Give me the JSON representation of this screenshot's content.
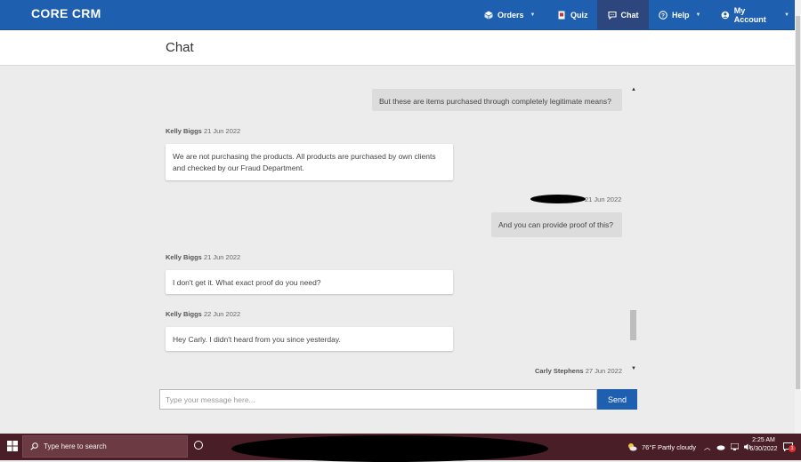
{
  "nav": {
    "brand": "CORE CRM",
    "items": [
      {
        "label": "Orders",
        "icon": "orders-icon",
        "dropdown": true
      },
      {
        "label": "Quiz",
        "icon": "quiz-icon",
        "dropdown": false
      },
      {
        "label": "Chat",
        "icon": "chat-icon",
        "dropdown": false,
        "active": true
      },
      {
        "label": "Help",
        "icon": "help-icon",
        "dropdown": true
      },
      {
        "label": "My Account",
        "icon": "account-icon",
        "dropdown": true
      }
    ]
  },
  "page": {
    "title": "Chat"
  },
  "messages": [
    {
      "direction": "out",
      "text": "But these are items purchased through completely legitimate means?"
    },
    {
      "direction": "in",
      "sender": "Kelly Biggs",
      "date": "21 Jun 2022",
      "text": "We are not purchasing the products. All products are purchased by own clients and checked by our Fraud Department."
    },
    {
      "direction": "out",
      "sender": "",
      "date": "21 Jun 2022",
      "text": "And you can provide proof of this?"
    },
    {
      "direction": "in",
      "sender": "Kelly Biggs",
      "date": "21 Jun 2022",
      "text": "I don't get it. What exact proof do you need?"
    },
    {
      "direction": "in",
      "sender": "Kelly Biggs",
      "date": "22 Jun 2022",
      "text": "Hey Carly. I didn't heard from you since yesterday."
    },
    {
      "direction": "out",
      "sender": "Carly Stephens",
      "date": "27 Jun 2022",
      "text": ""
    }
  ],
  "composer": {
    "placeholder": "Type your message here...",
    "send_label": "Send"
  },
  "taskbar": {
    "search_placeholder": "Type here to search",
    "weather": "76°F  Partly cloudy",
    "time": "2:25 AM",
    "date": "6/30/2022",
    "notification_count": "1"
  },
  "colors": {
    "primary": "#1e5fb0",
    "nav_active": "#2d467e",
    "taskbar": "#4a1e26"
  }
}
